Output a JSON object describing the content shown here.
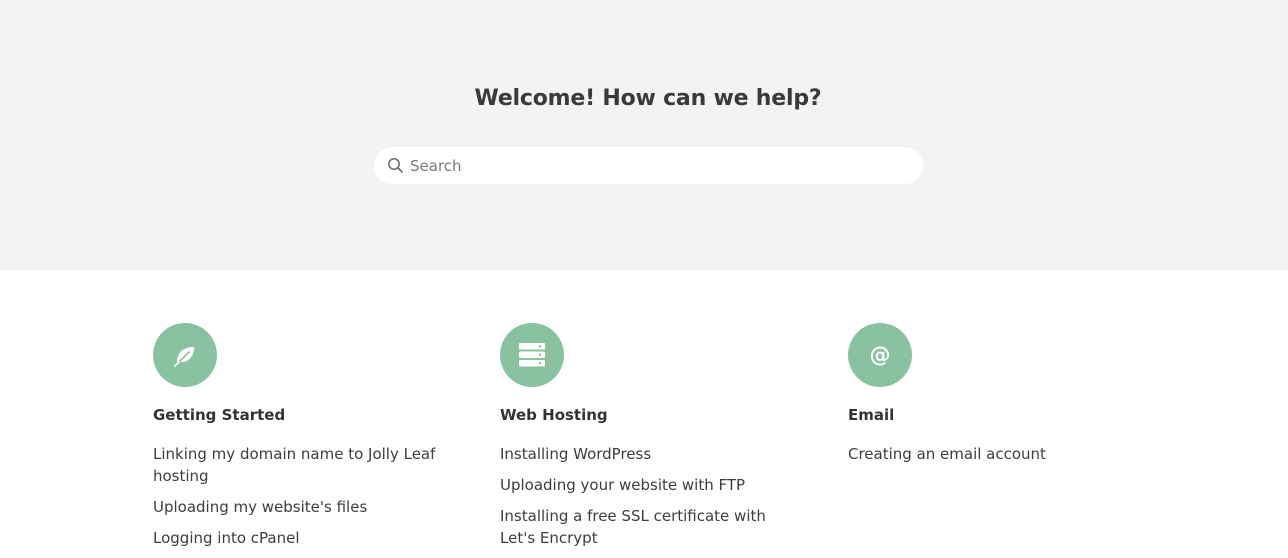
{
  "hero": {
    "title": "Welcome! How can we help?",
    "search_placeholder": "Search",
    "search_icon": "search-icon"
  },
  "categories": [
    {
      "icon": "leaf-icon",
      "title": "Getting Started",
      "links": [
        "Linking my domain name to Jolly Leaf hosting",
        "Uploading my website's files",
        "Logging into cPanel"
      ]
    },
    {
      "icon": "server-icon",
      "title": "Web Hosting",
      "links": [
        "Installing WordPress",
        "Uploading your website with FTP",
        "Installing a free SSL certificate with Let's Encrypt"
      ]
    },
    {
      "icon": "at-sign-icon",
      "title": "Email",
      "links": [
        "Creating an email account"
      ]
    }
  ],
  "colors": {
    "accent": "#88c2a0",
    "hero_bg": "#f3f3f3"
  }
}
